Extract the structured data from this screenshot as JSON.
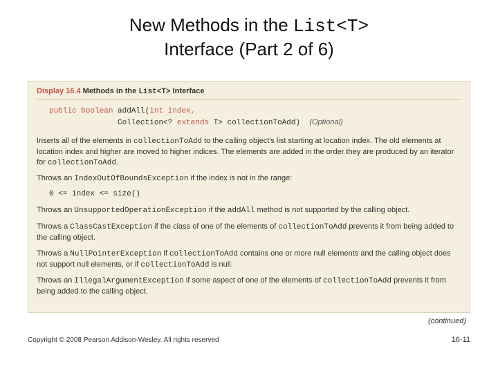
{
  "title": {
    "line1_pre": "New Methods in the ",
    "line1_code": "List<T>",
    "line2": "Interface (Part 2 of 6)"
  },
  "display": {
    "label": "Display 16.4",
    "heading_pre": "Methods in the ",
    "heading_code": "List<T>",
    "heading_post": " Interface"
  },
  "signature": {
    "mods": "public boolean",
    "name": "addAll(",
    "args_l1": "int index,",
    "args_l2_pre": "Collection<? ",
    "args_l2_kw": "extends",
    "args_l2_post": " T> collectionToAdd)",
    "optional": "(Optional)"
  },
  "body": {
    "p1_a": "Inserts all of the elements in ",
    "p1_code1": "collectionToAdd",
    "p1_b": " to the calling object's list starting at location index. The old elements at location index and higher are moved to higher indices. The elements are added in the order they are produced by an iterator for ",
    "p1_code2": "collectionToAdd",
    "p1_c": ".",
    "p2_a": "Throws an ",
    "p2_code": "IndexOutOfBoundsException",
    "p2_b": " if the index is not in the range:",
    "formula": "0 <= index <= size()",
    "p3_a": "Throws an ",
    "p3_code1": "UnsupportedOperationException",
    "p3_b": " if the ",
    "p3_code2": "addAll",
    "p3_c": " method is not supported by the calling object.",
    "p4_a": "Throws a ",
    "p4_code1": "ClassCastException",
    "p4_b": " if the class of one of the elements of ",
    "p4_code2": "collectionToAdd",
    "p4_c": " prevents it from being added to the calling object.",
    "p5_a": "Throws a ",
    "p5_code1": "NullPointerException",
    "p5_b": " if ",
    "p5_code2": "collectionToAdd",
    "p5_c": " contains one or more null elements and the calling object does not support null elements, or if ",
    "p5_code3": "collectionToAdd",
    "p5_d": " is null.",
    "p6_a": "Throws an ",
    "p6_code1": "IllegalArgumentException",
    "p6_b": " if some aspect of one of the elements of ",
    "p6_code2": "collectionToAdd",
    "p6_c": " prevents it from being added to the calling object."
  },
  "continued": "(continued)",
  "footer": {
    "copyright": "Copyright © 2008 Pearson Addison-Wesley. All rights reserved",
    "page": "16-11"
  }
}
